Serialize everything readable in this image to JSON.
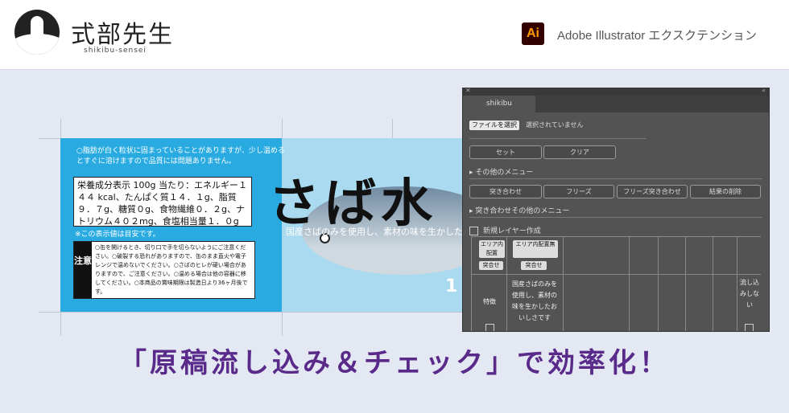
{
  "header": {
    "brand_name": "式部先生",
    "brand_sub": "shikibu-sensei",
    "ai_icon_label": "Ai",
    "extension_label": "Adobe Illustrator エクスクテンション"
  },
  "artwork": {
    "note_top": "○脂肪が白く粒状に固まっていることがありますが、少し温めるとすぐに溶けますので品質には問題ありません。",
    "nutrition": "栄養成分表示 100g 当たり：エネルギー１４４ kcal、たんぱく質１４．１g、脂質９．７g、糖質０g、食物繊維０．２g、ナトリウム４０２mg、食塩相当量１．０g",
    "standard": "※この表示値は目安です。",
    "caution_tag": "注意",
    "caution_text": "○缶を開けるとき、切り口で手を切らないようにご注意ください。○破裂する恐れがありますので、缶のまま直火や電子レンジで温めないでください。○さばのヒレが硬い場合がありますので、ご注意ください。○温める場合は他の容器に移してください。○本商品の賞味期限は製造日より36ヶ月後です。",
    "title_brush": "さば水",
    "catchcopy": "国産さばのみを使用し、素材の味を生かした",
    "bignum": "1"
  },
  "panel": {
    "tab": "shikibu",
    "file_button": "ファイルを選択",
    "file_status": "選択されていません",
    "set_button": "セット",
    "clear_button": "クリア",
    "other_menu": "▸ その他のメニュー",
    "buttons2": [
      "突き合わせ",
      "フリーズ",
      "フリーズ突き合わせ",
      "結果の削除"
    ],
    "other_menu2": "▸ 突き合わせその他のメニュー",
    "new_layer": "新規レイヤー作成",
    "grid": {
      "btn_area_in": "エリア内配置",
      "btn_compare1": "突合せ",
      "btn_area_none": "エリア内配置無",
      "btn_compare2": "突合せ",
      "row_label": "特徴",
      "row_text": "国産さばのみを使用し、素材の味を生かしたおいしさです",
      "right_text": "流し込みしない"
    }
  },
  "headline": "「原稿流し込み＆チェック」で効率化！"
}
